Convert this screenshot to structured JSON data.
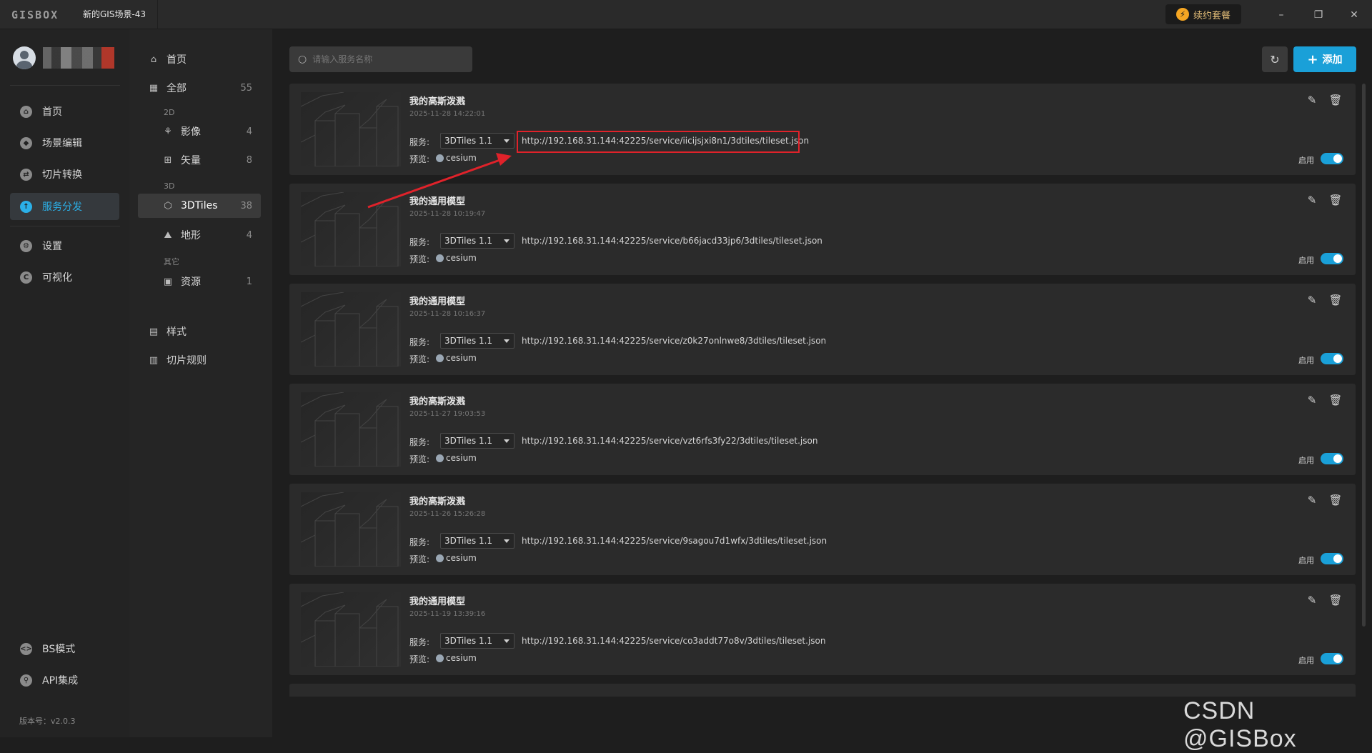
{
  "titlebar": {
    "logo": "GISBOX",
    "scene_title": "新的GIS场景-43",
    "renew_label": "续约套餐",
    "minimize": "–",
    "restore": "❐",
    "close": "✕"
  },
  "nav1": {
    "items": [
      {
        "label": "首页",
        "icon": "home-icon"
      },
      {
        "label": "场景编辑",
        "icon": "cube-icon"
      },
      {
        "label": "切片转换",
        "icon": "convert-icon"
      },
      {
        "label": "服务分发",
        "icon": "upload-icon"
      },
      {
        "label": "设置",
        "icon": "gear-icon"
      },
      {
        "label": "可视化",
        "icon": "chart-icon"
      },
      {
        "label": "BS模式",
        "icon": "code-icon"
      },
      {
        "label": "API集成",
        "icon": "link-icon"
      }
    ],
    "version": "版本号：v2.0.3"
  },
  "nav2": {
    "home": "首页",
    "all": {
      "label": "全部",
      "count": "55"
    },
    "group_2d": "2D",
    "imagery": {
      "label": "影像",
      "count": "4"
    },
    "vector": {
      "label": "矢量",
      "count": "8"
    },
    "group_3d": "3D",
    "tiles3d": {
      "label": "3DTiles",
      "count": "38"
    },
    "terrain": {
      "label": "地形",
      "count": "4"
    },
    "group_other": "其它",
    "resource": {
      "label": "资源",
      "count": "1"
    },
    "style": "样式",
    "tile_rules": "切片规则"
  },
  "toolbar": {
    "search_placeholder": "请输入服务名称",
    "add_label": "添加"
  },
  "labels": {
    "service": "服务:",
    "preview": "预览:",
    "enabled": "启用"
  },
  "services": [
    {
      "title": "我的高斯泼溅",
      "date": "2025-11-28 14:22:01",
      "version": "3DTiles 1.1",
      "url": "http://192.168.31.144:42225/service/iicijsjxi8n1/3dtiles/tileset.json",
      "preview": "cesium"
    },
    {
      "title": "我的通用模型",
      "date": "2025-11-28 10:19:47",
      "version": "3DTiles 1.1",
      "url": "http://192.168.31.144:42225/service/b66jacd33jp6/3dtiles/tileset.json",
      "preview": "cesium"
    },
    {
      "title": "我的通用模型",
      "date": "2025-11-28 10:16:37",
      "version": "3DTiles 1.1",
      "url": "http://192.168.31.144:42225/service/z0k27onlnwe8/3dtiles/tileset.json",
      "preview": "cesium"
    },
    {
      "title": "我的高斯泼溅",
      "date": "2025-11-27 19:03:53",
      "version": "3DTiles 1.1",
      "url": "http://192.168.31.144:42225/service/vzt6rfs3fy22/3dtiles/tileset.json",
      "preview": "cesium"
    },
    {
      "title": "我的高斯泼溅",
      "date": "2025-11-26 15:26:28",
      "version": "3DTiles 1.1",
      "url": "http://192.168.31.144:42225/service/9sagou7d1wfx/3dtiles/tileset.json",
      "preview": "cesium"
    },
    {
      "title": "我的通用模型",
      "date": "2025-11-19 13:39:16",
      "version": "3DTiles 1.1",
      "url": "http://192.168.31.144:42225/service/co3addt77o8v/3dtiles/tileset.json",
      "preview": "cesium"
    }
  ],
  "watermark": "CSDN @GISBox",
  "colors": {
    "accent": "#1aa0d8",
    "highlight": "#e0222a",
    "background": "#1e1e1e",
    "card": "#2b2b2b"
  }
}
